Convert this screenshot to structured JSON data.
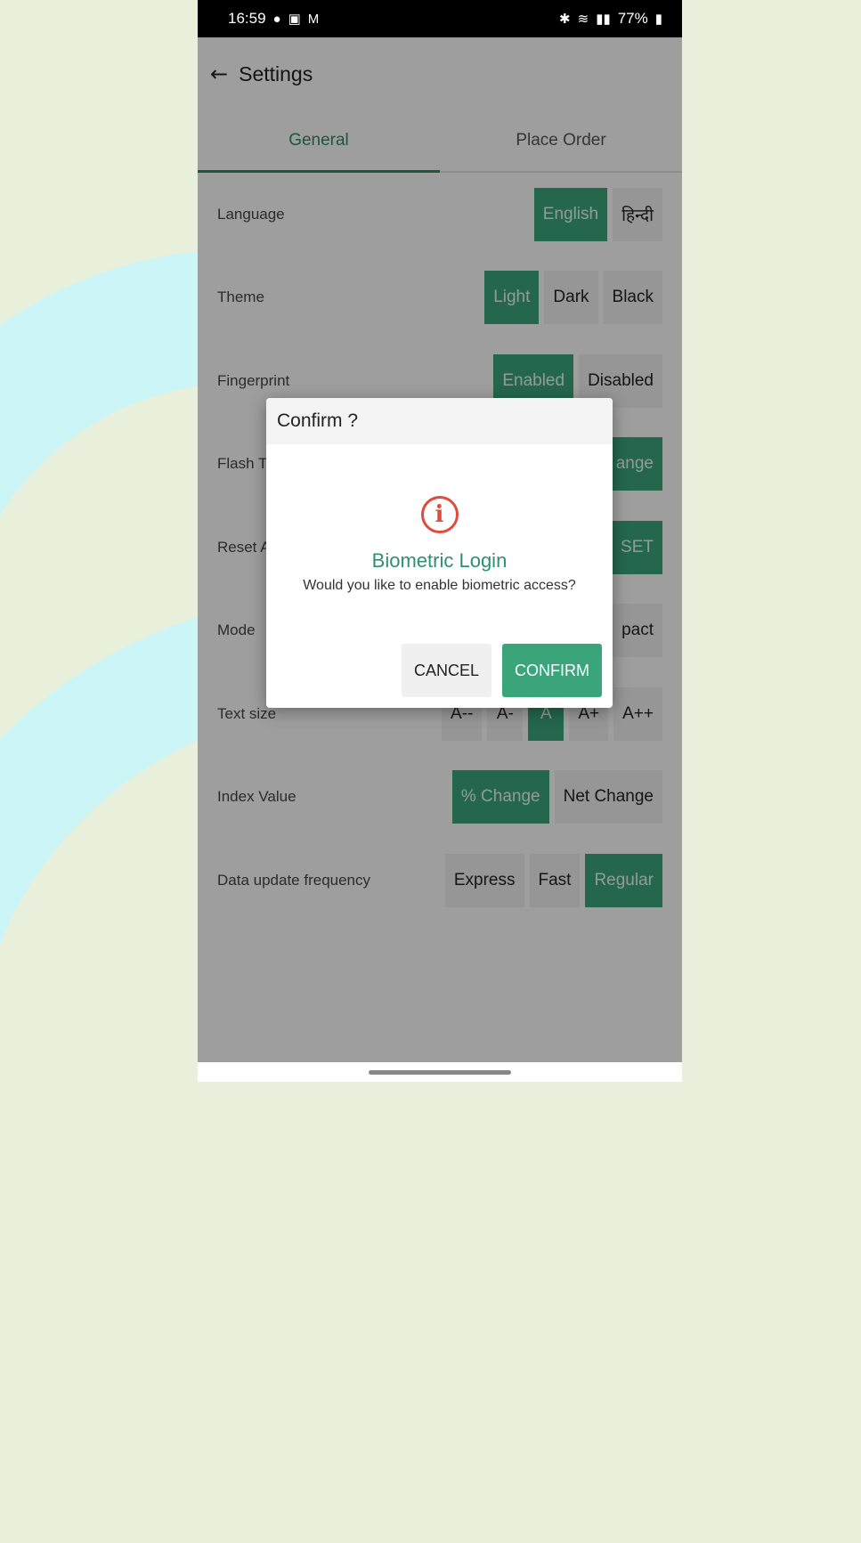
{
  "status_bar": {
    "time": "16:59",
    "left_icons": [
      "whatsapp-icon",
      "gallery-icon",
      "gmail-icon"
    ],
    "right_icons": [
      "bluetooth-icon",
      "wifi-icon",
      "signal-icon",
      "volte-icon"
    ],
    "battery": "77%"
  },
  "appbar": {
    "title": "Settings"
  },
  "tabs": [
    {
      "label": "General",
      "active": true
    },
    {
      "label": "Place Order",
      "active": false
    }
  ],
  "settings": [
    {
      "label": "Language",
      "options": [
        "English",
        "हिन्दी"
      ],
      "selected": 0
    },
    {
      "label": "Theme",
      "options": [
        "Light",
        "Dark",
        "Black"
      ],
      "selected": 0
    },
    {
      "label": "Fingerprint",
      "options": [
        "Enabled",
        "Disabled"
      ],
      "selected": 0
    },
    {
      "label": "Flash T",
      "options": [
        "ange"
      ],
      "selected": 0
    },
    {
      "label": "Reset A",
      "options": [
        "SET"
      ],
      "selected": 0
    },
    {
      "label": "Mode",
      "options": [
        "pact"
      ],
      "selected": -1
    },
    {
      "label": "Text size",
      "options": [
        "A--",
        "A-",
        "A",
        "A+",
        "A++"
      ],
      "selected": 2
    },
    {
      "label": "Index Value",
      "options": [
        "% Change",
        "Net Change"
      ],
      "selected": 0
    },
    {
      "label": "Data update frequency",
      "options": [
        "Express",
        "Fast",
        "Regular"
      ],
      "selected": 2
    }
  ],
  "dialog": {
    "header": "Confirm ?",
    "icon": "info-icon",
    "icon_glyph": "i",
    "title": "Biometric Login",
    "message": "Would you like to enable biometric access?",
    "cancel_label": "CANCEL",
    "confirm_label": "CONFIRM"
  },
  "colors": {
    "accent": "#3aa47a",
    "dialog_title": "#2f8f72",
    "icon_red": "#e04b3d"
  }
}
